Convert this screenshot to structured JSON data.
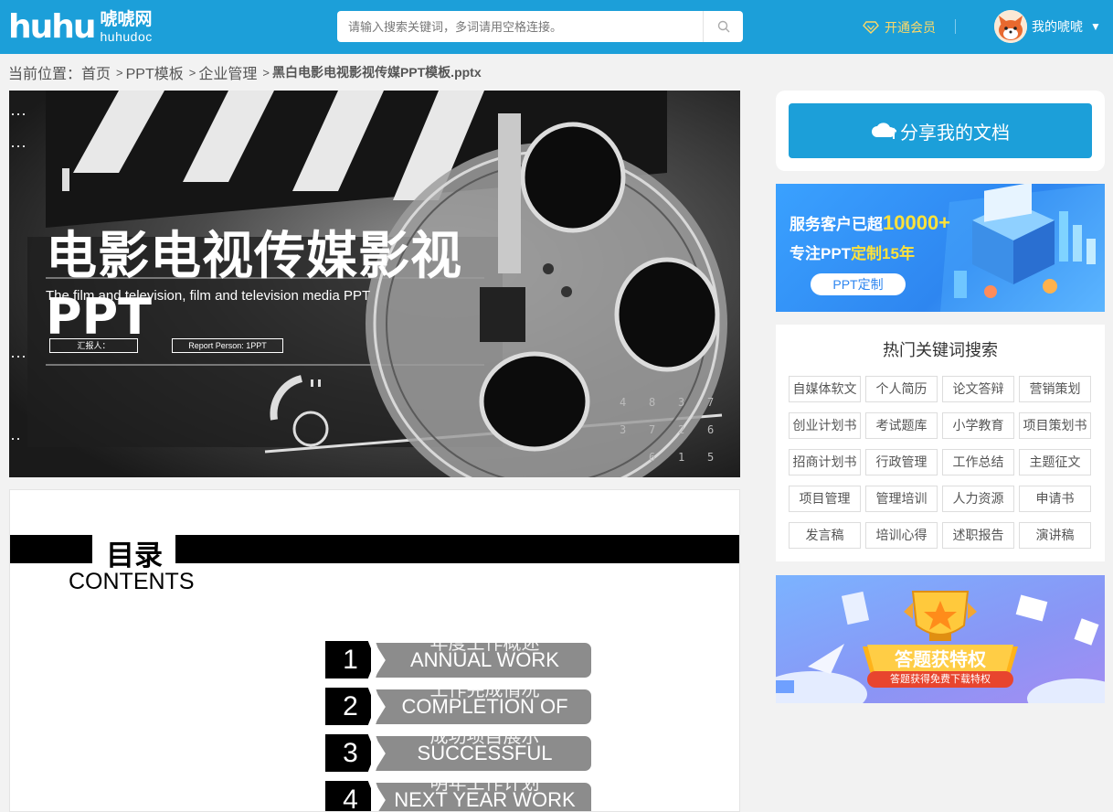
{
  "header": {
    "logo_mark": "huhu",
    "logo_cn": "唬唬网",
    "logo_en": "huhudoc",
    "search_placeholder": "请输入搜索关键词，多词请用空格连接。",
    "vip_label": "开通会员",
    "user_label": "我的唬唬",
    "caret": "▼"
  },
  "breadcrumb": {
    "prefix": "当前位置：",
    "items": [
      "首页",
      "PPT模板",
      "企业管理"
    ],
    "separator": ">",
    "current": "黑白电影电视影视传媒PPT模板.pptx"
  },
  "slide1": {
    "title": "电影电视传媒影视",
    "title2": "PPT",
    "subtitle": "The film and television, film and television media PPT",
    "tag_reporter": "汇报人：",
    "tag_person": "Report Person: 1PPT"
  },
  "slide2": {
    "toc_title": "目录",
    "toc_sub": "CONTENTS",
    "items": [
      {
        "num": "1",
        "cn": "年度工作概述",
        "en": "ANNUAL WORK"
      },
      {
        "num": "2",
        "cn": "工作完成情况",
        "en": "COMPLETION OF"
      },
      {
        "num": "3",
        "cn": "成功项目展示",
        "en": "SUCCESSFUL"
      },
      {
        "num": "4",
        "cn": "明年工作计划",
        "en": "NEXT YEAR WORK"
      }
    ]
  },
  "sidebar": {
    "share_label": "分享我的文档",
    "ad1": {
      "line1": "服务客户已超",
      "line1_hl": "10000+",
      "line2": "专注PPT",
      "line2_hl": "定制15年",
      "button": "PPT定制"
    },
    "keywords_title": "热门关键词搜索",
    "keywords": [
      "自媒体软文",
      "个人简历",
      "论文答辩",
      "营销策划",
      "创业计划书",
      "考试题库",
      "小学教育",
      "项目策划书",
      "招商计划书",
      "行政管理",
      "工作总结",
      "主题征文",
      "项目管理",
      "管理培训",
      "人力资源",
      "申请书",
      "发言稿",
      "培训心得",
      "述职报告",
      "演讲稿"
    ],
    "ad2": {
      "title": "答题获特权",
      "sub": "答题获得免费下载特权"
    }
  },
  "colors": {
    "brand": "#1c9fd9",
    "vip": "#ffd966",
    "toc_item_bg": "#8c8c8c"
  }
}
